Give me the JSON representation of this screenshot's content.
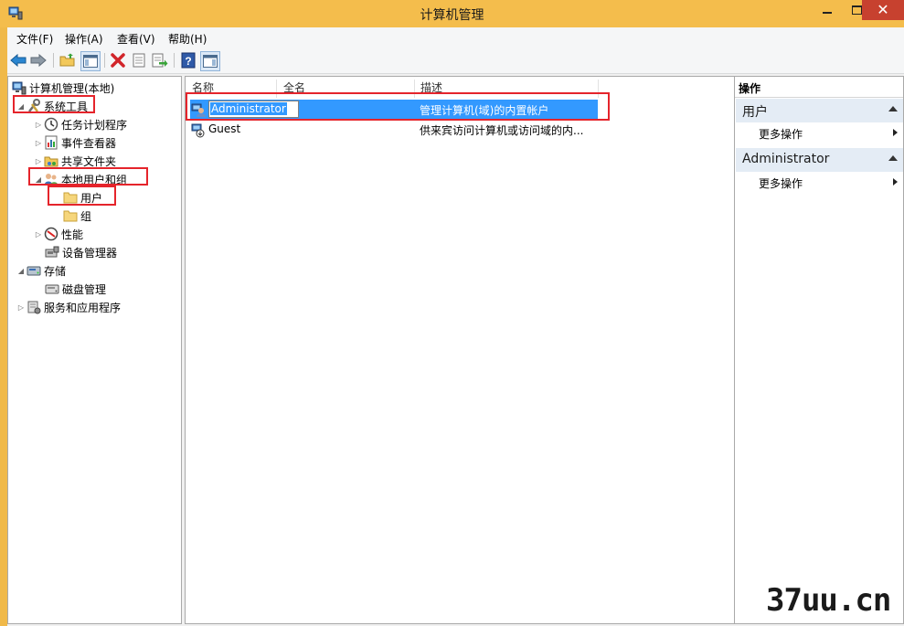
{
  "window": {
    "title": "计算机管理",
    "close_symbol": "✕"
  },
  "menu": [
    "文件(F)",
    "操作(A)",
    "查看(V)",
    "帮助(H)"
  ],
  "toolbar": [
    "back",
    "forward",
    "up-folder",
    "show-hide-tree",
    "delete",
    "properties",
    "export",
    "help",
    "show-hide-action-pane"
  ],
  "tree": [
    {
      "label": "计算机管理(本地)",
      "icon": "computer-management-icon",
      "expander": ""
    },
    {
      "label": "系统工具",
      "icon": "tools-icon",
      "expander": "◢"
    },
    {
      "label": "任务计划程序",
      "icon": "clock-icon",
      "expander": "▷"
    },
    {
      "label": "事件查看器",
      "icon": "event-viewer-icon",
      "expander": "▷"
    },
    {
      "label": "共享文件夹",
      "icon": "shared-folder-icon",
      "expander": "▷"
    },
    {
      "label": "本地用户和组",
      "icon": "users-group-icon",
      "expander": "◢"
    },
    {
      "label": "用户",
      "icon": "folder-icon",
      "expander": ""
    },
    {
      "label": "组",
      "icon": "folder-icon",
      "expander": ""
    },
    {
      "label": "性能",
      "icon": "performance-icon",
      "expander": "▷"
    },
    {
      "label": "设备管理器",
      "icon": "device-manager-icon",
      "expander": ""
    },
    {
      "label": "存储",
      "icon": "storage-icon",
      "expander": "◢"
    },
    {
      "label": "磁盘管理",
      "icon": "disk-icon",
      "expander": ""
    },
    {
      "label": "服务和应用程序",
      "icon": "services-icon",
      "expander": "▷"
    }
  ],
  "list": {
    "columns": [
      "名称",
      "全名",
      "描述"
    ],
    "rows": [
      {
        "name": "Administrator",
        "fullname": "",
        "description": "管理计算机(域)的内置帐户",
        "selected": true
      },
      {
        "name": "Guest",
        "fullname": "",
        "description": "供来宾访问计算机或访问域的内...",
        "selected": false
      }
    ]
  },
  "actions": {
    "header": "操作",
    "sections": [
      {
        "title": "用户",
        "item": "更多操作"
      },
      {
        "title": "Administrator",
        "item": "更多操作"
      }
    ]
  },
  "watermark": "37uu.cn",
  "colors": {
    "title_bar": "#f4bd4c",
    "selection": "#3399ff",
    "highlight_box": "#e5242b",
    "close_button": "#c7412f"
  }
}
